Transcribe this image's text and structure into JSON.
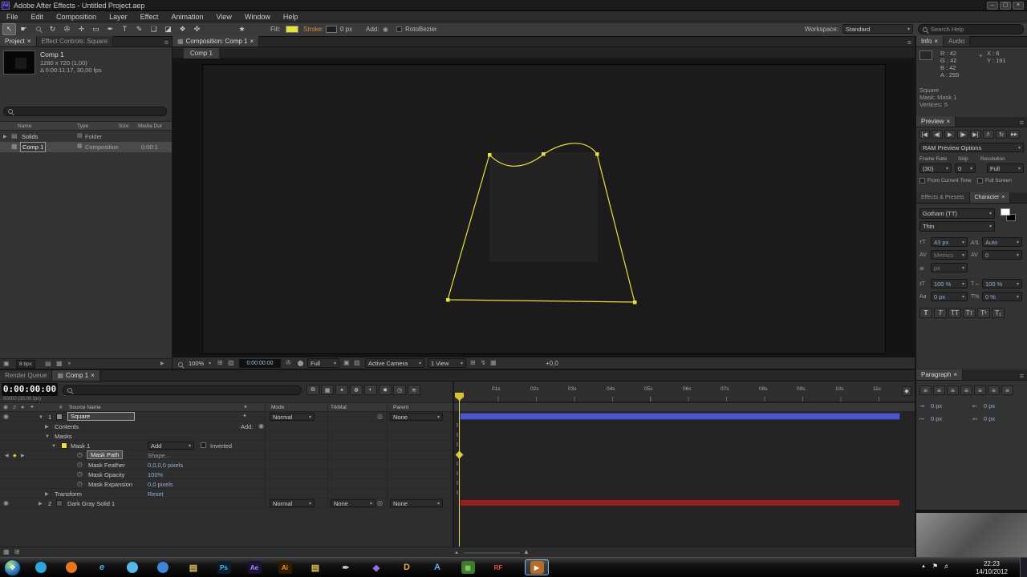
{
  "colors": {
    "mask_yellow": "#e8e23c",
    "fill_yellow": "#e6e23a",
    "layer_bar_blue": "#4a58c8",
    "solid_bar_red": "#8e2222",
    "cti_yellow": "#e8d84a"
  },
  "window": {
    "title": "Adobe After Effects - Untitled Project.aep"
  },
  "menubar": {
    "items": [
      "File",
      "Edit",
      "Composition",
      "Layer",
      "Effect",
      "Animation",
      "View",
      "Window",
      "Help"
    ]
  },
  "toolbar": {
    "fill_label": "Fill:",
    "stroke_label": "Stroke:",
    "stroke_width": "0 px",
    "add_label": "Add:",
    "rotobezier": "RotoBezier",
    "workspace_label": "Workspace:",
    "workspace_value": "Standard",
    "search_placeholder": "Search Help"
  },
  "project": {
    "tab_project": "Project",
    "tab_effect_controls": "Effect Controls: Square",
    "comp_name": "Comp 1",
    "comp_size": "1280 x 720 (1,00)",
    "comp_duration": "Δ 0:00:11:17, 30,00 fps",
    "columns": {
      "name": "Name",
      "type": "Type",
      "size": "Size",
      "media": "Media Dur"
    },
    "rows": [
      {
        "name": "Solids",
        "type": "Folder",
        "media": ""
      },
      {
        "name": "Comp 1",
        "type": "Composition",
        "media": "0:00:1"
      }
    ],
    "bpc": "8 bpc"
  },
  "comp": {
    "tab": "Composition: Comp 1",
    "viewer_tab": "Comp 1",
    "zoom": "100%",
    "timecode": "0:00:00:00",
    "resolution": "Full",
    "camera": "Active Camera",
    "view_layout": "1 View",
    "exposure": "+0,0"
  },
  "info": {
    "tab_info": "Info",
    "tab_audio": "Audio",
    "r": "R : 42",
    "g": "G : 42",
    "b": "B : 42",
    "a": "A : 255",
    "x": "X : 6",
    "y": "Y : 191",
    "line1": "Square",
    "line2": "Mask: Mask 1",
    "line3": "Vertices: 5"
  },
  "preview": {
    "tab": "Preview",
    "ram_options": "RAM Preview Options",
    "frame_rate_label": "Frame Rate",
    "skip_label": "Skip",
    "resolution_label": "Resolution",
    "frame_rate": "(30)",
    "skip": "0",
    "resolution": "Full",
    "from_current_time": "From Current Time",
    "full_screen": "Full Screen"
  },
  "character": {
    "tab_effects": "Effects & Presets",
    "tab_character": "Character",
    "font_family": "Gotham (TT)",
    "font_style": "Thin",
    "font_size": "43 px",
    "leading": "Auto",
    "kerning": "Metrics",
    "tracking": "0",
    "stroke_width": "px",
    "vertical_scale": "100 %",
    "horizontal_scale": "100 %",
    "baseline_shift": "0 px",
    "tsume": "0 %"
  },
  "paragraph": {
    "tab": "Paragraph",
    "indent_left": "0 px",
    "indent_right": "0 px",
    "space_before": "0 px",
    "space_after": "0 px"
  },
  "timeline": {
    "tab_render_queue": "Render Queue",
    "tab_comp": "Comp 1",
    "timecode": "0:00:00:00",
    "frame_info": "00000 (30.00 fps)",
    "columns": {
      "source_name": "Source Name",
      "mode": "Mode",
      "trkmat": "TrkMat",
      "parent": "Parent"
    },
    "add_label": "Add:",
    "contents_label": "Contents",
    "masks_label": "Masks",
    "layer1": {
      "number": "1",
      "name": "Square",
      "mode": "Normal",
      "parent": "None"
    },
    "mask1": {
      "name": "Mask 1",
      "blend": "Add",
      "inverted_label": "Inverted"
    },
    "props": [
      {
        "label": "Mask Path",
        "value": "Shape..."
      },
      {
        "label": "Mask Feather",
        "value": "0,0,0,0 pixels"
      },
      {
        "label": "Mask Opacity",
        "value": "100%"
      },
      {
        "label": "Mask Expansion",
        "value": "0,0 pixels"
      }
    ],
    "transform": {
      "label": "Transform",
      "value": "Reset"
    },
    "layer2": {
      "number": "2",
      "name": "Dark Gray Solid 1",
      "mode": "Normal",
      "trkmat": "None",
      "parent": "None"
    },
    "ruler": [
      "01s",
      "02s",
      "03s",
      "04s",
      "05s",
      "06s",
      "07s",
      "08s",
      "09s",
      "10s",
      "11s"
    ]
  },
  "taskbar": {
    "time": "22:23",
    "date": "14/10/2012",
    "icons": [
      {
        "name": "messenger-icon",
        "kind": "c",
        "bg": "#2fa8e0",
        "fg": "#ffffff",
        "label": ""
      },
      {
        "name": "firefox-icon",
        "kind": "c",
        "bg": "#e8751e",
        "fg": "#ffffff",
        "label": ""
      },
      {
        "name": "internet-explorer-icon",
        "kind": "g",
        "bg": "",
        "fg": "#53b0e8",
        "label": "e"
      },
      {
        "name": "twitter-icon",
        "kind": "c",
        "bg": "#55b8e8",
        "fg": "#ffffff",
        "label": ""
      },
      {
        "name": "skype-icon",
        "kind": "c",
        "bg": "#3f86d8",
        "fg": "#ffffff",
        "label": ""
      },
      {
        "name": "folder-icon",
        "kind": "g",
        "bg": "",
        "fg": "#e0c060",
        "label": "▤"
      },
      {
        "name": "photoshop-icon",
        "kind": "t",
        "bg": "#0a1e30",
        "fg": "#57b4f0",
        "label": "Ps"
      },
      {
        "name": "after-effects-icon",
        "kind": "t",
        "bg": "#1c1236",
        "fg": "#a891f0",
        "label": "Ae"
      },
      {
        "name": "illustrator-icon",
        "kind": "t",
        "bg": "#301c02",
        "fg": "#f09a2a",
        "label": "Ai"
      },
      {
        "name": "folder2-icon",
        "kind": "g",
        "bg": "",
        "fg": "#e0c060",
        "label": "▤"
      },
      {
        "name": "pen-icon",
        "kind": "g",
        "bg": "",
        "fg": "#cccccc",
        "label": "✒"
      },
      {
        "name": "cube-icon",
        "kind": "g",
        "bg": "",
        "fg": "#9a6ae8",
        "label": "◆"
      },
      {
        "name": "daz-icon",
        "kind": "g",
        "bg": "",
        "fg": "#e0b040",
        "label": "D"
      },
      {
        "name": "a-app-icon",
        "kind": "g",
        "bg": "",
        "fg": "#6aa8f0",
        "label": "A"
      },
      {
        "name": "minecraft-icon",
        "kind": "t",
        "bg": "#3f7a2e",
        "fg": "#85cc60",
        "label": "▦"
      },
      {
        "name": "rf-icon",
        "kind": "g",
        "bg": "",
        "fg": "#e85040",
        "label": "RF"
      },
      {
        "name": "active-app-icon",
        "kind": "t",
        "bg": "#b86a28",
        "fg": "#ffffff",
        "label": "▶"
      }
    ]
  }
}
